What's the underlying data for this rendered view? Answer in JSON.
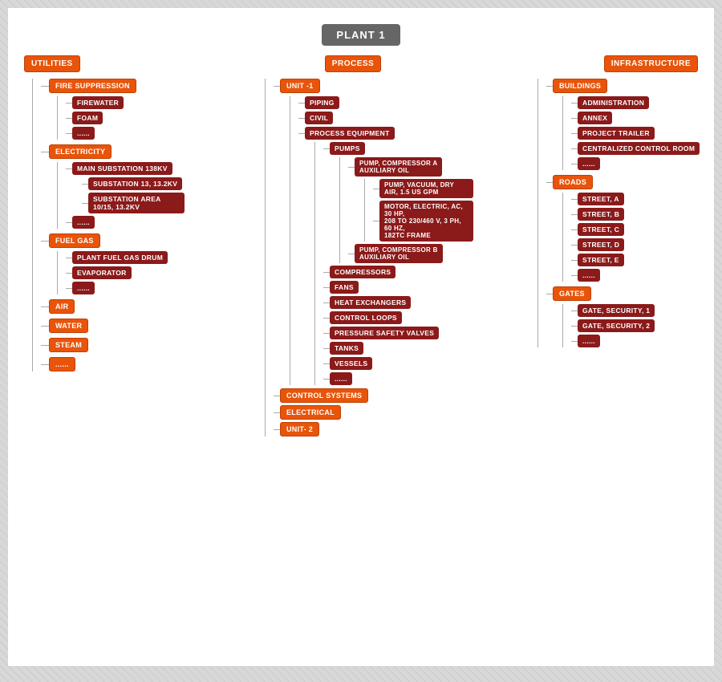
{
  "root": {
    "label": "PLANT 1"
  },
  "columns": {
    "left": {
      "header": "UTILITIES",
      "sections": [
        {
          "label": "FIRE SUPPRESSION",
          "children": [
            {
              "label": "FIREWATER"
            },
            {
              "label": "FOAM"
            },
            {
              "label": "......"
            }
          ]
        },
        {
          "label": "ELECTRICITY",
          "children": [
            {
              "label": "MAIN SUBSTATION 138KV"
            },
            {
              "label": "SUBSTATION 13, 13.2KV"
            },
            {
              "label": "SUBSTATION AREA 10/15, 13.2KV"
            },
            {
              "label": "......"
            }
          ]
        },
        {
          "label": "FUEL GAS",
          "children": [
            {
              "label": "PLANT FUEL GAS DRUM"
            },
            {
              "label": "EVAPORATOR"
            },
            {
              "label": "......"
            }
          ]
        },
        {
          "label": "AIR",
          "children": []
        },
        {
          "label": "WATER",
          "children": []
        },
        {
          "label": "STEAM",
          "children": []
        },
        {
          "label": "......",
          "children": []
        }
      ]
    },
    "center": {
      "header": "PROCESS",
      "sections": [
        {
          "label": "UNIT -1",
          "children": [
            {
              "label": "PIPING"
            },
            {
              "label": "CIVIL"
            },
            {
              "label": "PROCESS EQUIPMENT",
              "children": [
                {
                  "label": "PUMPS",
                  "children": [
                    {
                      "label": "PUMP, COMPRESSOR A AUXILIARY OIL",
                      "children": [
                        {
                          "label": "PUMP, VACUUM, DRY AIR, 1.5 US GPM"
                        },
                        {
                          "label": "MOTOR, ELECTRIC, AC, 30 HP, 208 TO 230/460 V, 3 PH, 60 HZ, 182TC FRAME"
                        }
                      ]
                    },
                    {
                      "label": "PUMP, COMPRESSOR B AUXILIARY OIL"
                    }
                  ]
                },
                {
                  "label": "COMPRESSORS"
                },
                {
                  "label": "FANS"
                },
                {
                  "label": "HEAT EXCHANGERS"
                },
                {
                  "label": "CONTROL LOOPS"
                },
                {
                  "label": "PRESSURE SAFETY VALVES"
                },
                {
                  "label": "TANKS"
                },
                {
                  "label": "VESSELS"
                },
                {
                  "label": "......"
                }
              ]
            }
          ]
        },
        {
          "label": "CONTROL SYSTEMS"
        },
        {
          "label": "ELECTRICAL"
        },
        {
          "label": "UNIT- 2"
        }
      ]
    },
    "right": {
      "header": "INFRASTRUCTURE",
      "sections": [
        {
          "label": "BUILDINGS",
          "children": [
            {
              "label": "ADMINISTRATION"
            },
            {
              "label": "ANNEX"
            },
            {
              "label": "PROJECT TRAILER"
            },
            {
              "label": "CENTRALIZED CONTROL ROOM"
            },
            {
              "label": "......"
            }
          ]
        },
        {
          "label": "ROADS",
          "children": [
            {
              "label": "STREET, A"
            },
            {
              "label": "STREET, B"
            },
            {
              "label": "STREET, C"
            },
            {
              "label": "STREET, D"
            },
            {
              "label": "STREET, E"
            },
            {
              "label": "......"
            }
          ]
        },
        {
          "label": "GATES",
          "children": [
            {
              "label": "GATE, SECURITY, 1"
            },
            {
              "label": "GATE, SECURITY, 2"
            },
            {
              "label": "......"
            }
          ]
        }
      ]
    }
  }
}
